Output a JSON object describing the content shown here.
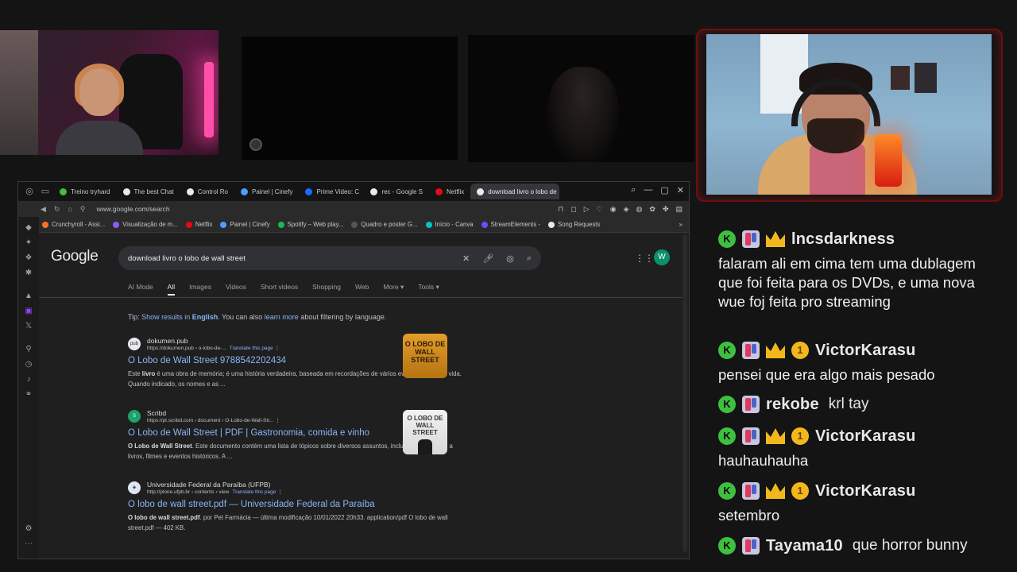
{
  "browser": {
    "tabs": [
      {
        "label": "Treino tryhard",
        "color": "#3fbf3f"
      },
      {
        "label": "The best Chat",
        "color": "#e8eaed"
      },
      {
        "label": "Control Ro",
        "color": "#e8eaed"
      },
      {
        "label": "Painel | Cinefy",
        "color": "#4a9eff"
      },
      {
        "label": "Prime Video: C",
        "color": "#1a6bff"
      },
      {
        "label": "rec - Google S",
        "color": "#e8eaed"
      },
      {
        "label": "Netflix",
        "color": "#e50914"
      },
      {
        "label": "download livro o lobo de",
        "color": "#e8eaed"
      }
    ],
    "url": "www.google.com/search",
    "bookmarks": [
      {
        "label": "Crunchyroll - Assi...",
        "color": "#f47521"
      },
      {
        "label": "Visualização de m...",
        "color": "#8a5cf6"
      },
      {
        "label": "Netflix",
        "color": "#e50914"
      },
      {
        "label": "Painel | Cinefy",
        "color": "#4a9eff"
      },
      {
        "label": "Spotify – Web play...",
        "color": "#1db954"
      },
      {
        "label": "Quadro e poster G...",
        "color": "#555555"
      },
      {
        "label": "Início - Canva",
        "color": "#00c4cc"
      },
      {
        "label": "StreamElements -",
        "color": "#6a4cff"
      },
      {
        "label": "Song Requests",
        "color": "#e8eaed"
      }
    ]
  },
  "google": {
    "logo": "Google",
    "query": "download livro o lobo de wall street",
    "avatar_letter": "W",
    "tabs": [
      "AI Mode",
      "All",
      "Images",
      "Videos",
      "Short videos",
      "Shopping",
      "Web",
      "More ▾",
      "Tools ▾"
    ],
    "tip": {
      "prefix": "Tip: ",
      "show": "Show results in ",
      "english": "English",
      "mid": ". You can also ",
      "learn": "learn more",
      "suffix": " about filtering by language."
    },
    "results": [
      {
        "site": "dokumen.pub",
        "url": "https://dokumen.pub › o-lobo-de-...",
        "translate": "Translate this page",
        "title": "O Lobo de Wall Street 9788542202434",
        "snippet_bold": "livro",
        "snippet_a": "Este ",
        "snippet_b": " é uma obra de memória; é uma história verdadeira, baseada em recordações de vários eventos de minha vida. Quando indicado, os nomes e as ...",
        "thumb": "O LOBO DE WALL STREET"
      },
      {
        "site": "Scribd",
        "url": "https://pt.scribd.com › document › O-Lobo-de-Wall-Str...",
        "translate": "",
        "title": "O Lobo de Wall Street | PDF | Gastronomia, comida e vinho",
        "snippet_bold": "O Lobo de Wall Street",
        "snippet_a": "",
        "snippet_b": ". Este documento contém uma lista de tópicos sobre diversos assuntos, incluindo referências a livros, filmes e eventos históricos. A ...",
        "thumb": "O LOBO DE WALL STREET"
      },
      {
        "site": "Universidade Federal da Paraíba (UFPB)",
        "url": "http://plone.ufpb.br › contents › view",
        "translate": "Translate this page",
        "title": "O lobo de wall street.pdf — Universidade Federal da Paraíba",
        "snippet_bold": "O lobo de wall street.pdf",
        "snippet_a": "",
        "snippet_b": ". por Pet Farmácia — última modificação 10/01/2022 20h33. application/pdf O lobo de wall street.pdf — 402 KB."
      }
    ]
  },
  "chat": [
    {
      "user": "lncsdarkness",
      "badges": [
        "k",
        "mod",
        "crown"
      ],
      "text": "falaram ali em cima tem uma dublagem que foi feita para os DVDs, e uma nova wue foj feita pro streaming",
      "inline": ""
    },
    {
      "user": "VictorKarasu",
      "badges": [
        "k",
        "mod",
        "crown",
        "one"
      ],
      "text": "pensei que era algo mais pesado",
      "inline": ""
    },
    {
      "user": "rekobe",
      "badges": [
        "k",
        "mod"
      ],
      "text": "",
      "inline": "krl tay"
    },
    {
      "user": "VictorKarasu",
      "badges": [
        "k",
        "mod",
        "crown",
        "one"
      ],
      "text": "hauhauhauha",
      "inline": ""
    },
    {
      "user": "VictorKarasu",
      "badges": [
        "k",
        "mod",
        "crown",
        "one"
      ],
      "text": "setembro",
      "inline": ""
    },
    {
      "user": "Tayama10",
      "badges": [
        "k",
        "mod"
      ],
      "text": "",
      "inline": "que horror bunny"
    }
  ],
  "colors": {
    "accent_link": "#8ab4f8",
    "chat_k": "#3fbf3f",
    "gold": "#f2b71d",
    "frame_red": "#6a1010"
  }
}
